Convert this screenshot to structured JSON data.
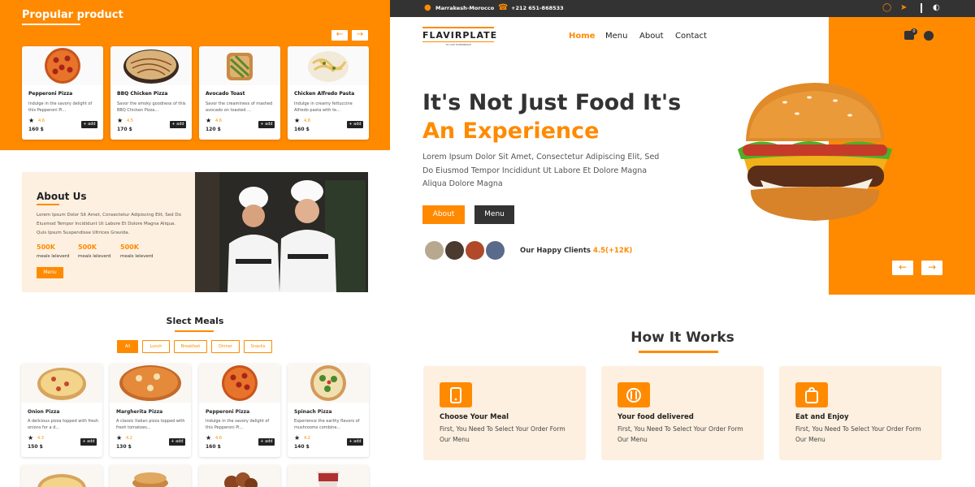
{
  "colors": {
    "accent": "#ff8a00",
    "dark": "#333333",
    "cream": "#fdf0e0"
  },
  "popular": {
    "title": "Propular product",
    "items": [
      {
        "name": "Pepperoni Pizza",
        "desc": "Indulge in the savory delight of this Pepperoni Pi...",
        "rating": "4.6",
        "price": "160 $",
        "add": "+ add"
      },
      {
        "name": "BBQ Chicken Pizza",
        "desc": "Savor the smoky goodness of this BBQ Chicken Pizza...",
        "rating": "4.5",
        "price": "170 $",
        "add": "+ add"
      },
      {
        "name": "Avocado Toast",
        "desc": "Savor the creaminess of mashed avocado on toasted ...",
        "rating": "4.6",
        "price": "120 $",
        "add": "+ add"
      },
      {
        "name": "Chicken Alfredo Pasta",
        "desc": "Indulge in creamy fettuccine Alfredo pasta with te...",
        "rating": "4.8",
        "price": "160 $",
        "add": "+ add"
      }
    ]
  },
  "about": {
    "title": "About Us",
    "text": "Lorem Ipsum Dolor Sit Amet, Consectetur Adipiscing Elit, Sed Do Eiusmod Tempor Incididunt Ut Labore Et Dolore Magna Aliqua. Quis Ipsum Suspendisse Ultrices Gravida.",
    "stats": [
      {
        "num": "500K",
        "label": "meals leleverd"
      },
      {
        "num": "500K",
        "label": "meals leleverd"
      },
      {
        "num": "500K",
        "label": "meals leleverd"
      }
    ],
    "button": "Menu"
  },
  "meals": {
    "title": "Slect Meals",
    "filters": [
      "All",
      "Lunch",
      "Breakfast",
      "Dinner",
      "Snacks"
    ],
    "items": [
      {
        "name": "Onion Pizza",
        "desc": "A delicious pizza topped with fresh onions for a d...",
        "rating": "4.3",
        "price": "150 $",
        "add": "+ add"
      },
      {
        "name": "Margherita Pizza",
        "desc": "A classic Italian pizza topped with fresh tomatoes...",
        "rating": "4.2",
        "price": "130 $",
        "add": "+ add"
      },
      {
        "name": "Pepperoni Pizza",
        "desc": "Indulge in the savory delight of this Pepperoni Pi...",
        "rating": "4.6",
        "price": "160 $",
        "add": "+ add"
      },
      {
        "name": "Spinach Pizza",
        "desc": "Experience the earthy flavors of mushrooms combine...",
        "rating": "4.2",
        "price": "140 $",
        "add": "+ add"
      }
    ]
  },
  "topbar": {
    "location": "Marrakesh-Morocco",
    "phone": "+212 651-868533"
  },
  "header": {
    "logo": "FLAVIRPLATE",
    "logo_tag": "TO LIVE EXPERIENCE",
    "nav": [
      "Home",
      "Menu",
      "About",
      "Contact"
    ]
  },
  "hero": {
    "line1": "It's Not Just Food It's",
    "line2": "An Experience",
    "text": "Lorem Ipsum Dolor Sit Amet, Consectetur Adipiscing Elit, Sed Do Eiusmod Tempor Incididunt Ut Labore Et Dolore Magna Aliqua Dolore Magna",
    "btn_about": "About",
    "btn_menu": "Menu",
    "clients_label": "Our Happy Clients",
    "clients_rating": "4.5(+12K)",
    "cart_count": "0"
  },
  "how": {
    "title": "How It Works",
    "steps": [
      {
        "title": "Choose Your Meal",
        "text": "First, You Need To Select Your Order Form Our Menu",
        "icon": "phone-icon"
      },
      {
        "title": "Your food delivered",
        "text": "First, You Need To Select Your Order Form Our Menu",
        "icon": "dish-icon"
      },
      {
        "title": "Eat and Enjoy",
        "text": "First, You Need To Select Your Order Form Our Menu",
        "icon": "bag-icon"
      }
    ]
  }
}
